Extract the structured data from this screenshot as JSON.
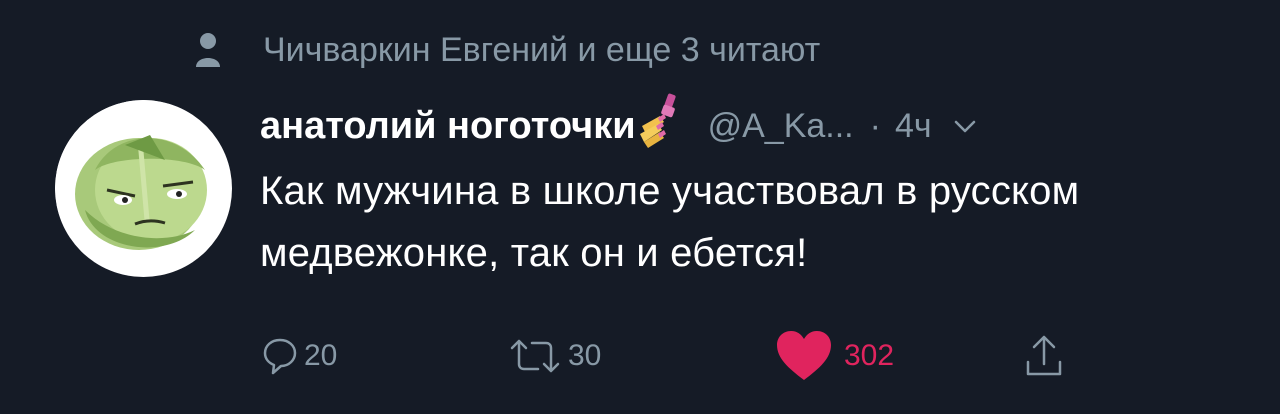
{
  "social_context": {
    "text": "Чичваркин Евгений и еще 3 читают",
    "icon": "person-icon"
  },
  "tweet": {
    "display_name": "анатолий ноготочки",
    "emoji": "nail-polish-emoji",
    "handle": "@A_Ka...",
    "separator": "·",
    "time": "4ч",
    "text": "Как мужчина в школе участвовал в русском медвежонке, так он и ебется!",
    "avatar": "cabbage-avatar"
  },
  "actions": {
    "reply": {
      "icon": "reply-icon",
      "count": "20"
    },
    "retweet": {
      "icon": "retweet-icon",
      "count": "30"
    },
    "like": {
      "icon": "heart-icon",
      "count": "302",
      "liked": true
    },
    "share": {
      "icon": "share-icon"
    }
  },
  "colors": {
    "background": "#151b26",
    "muted": "#8899a6",
    "like": "#e0245e",
    "text": "#ffffff"
  }
}
